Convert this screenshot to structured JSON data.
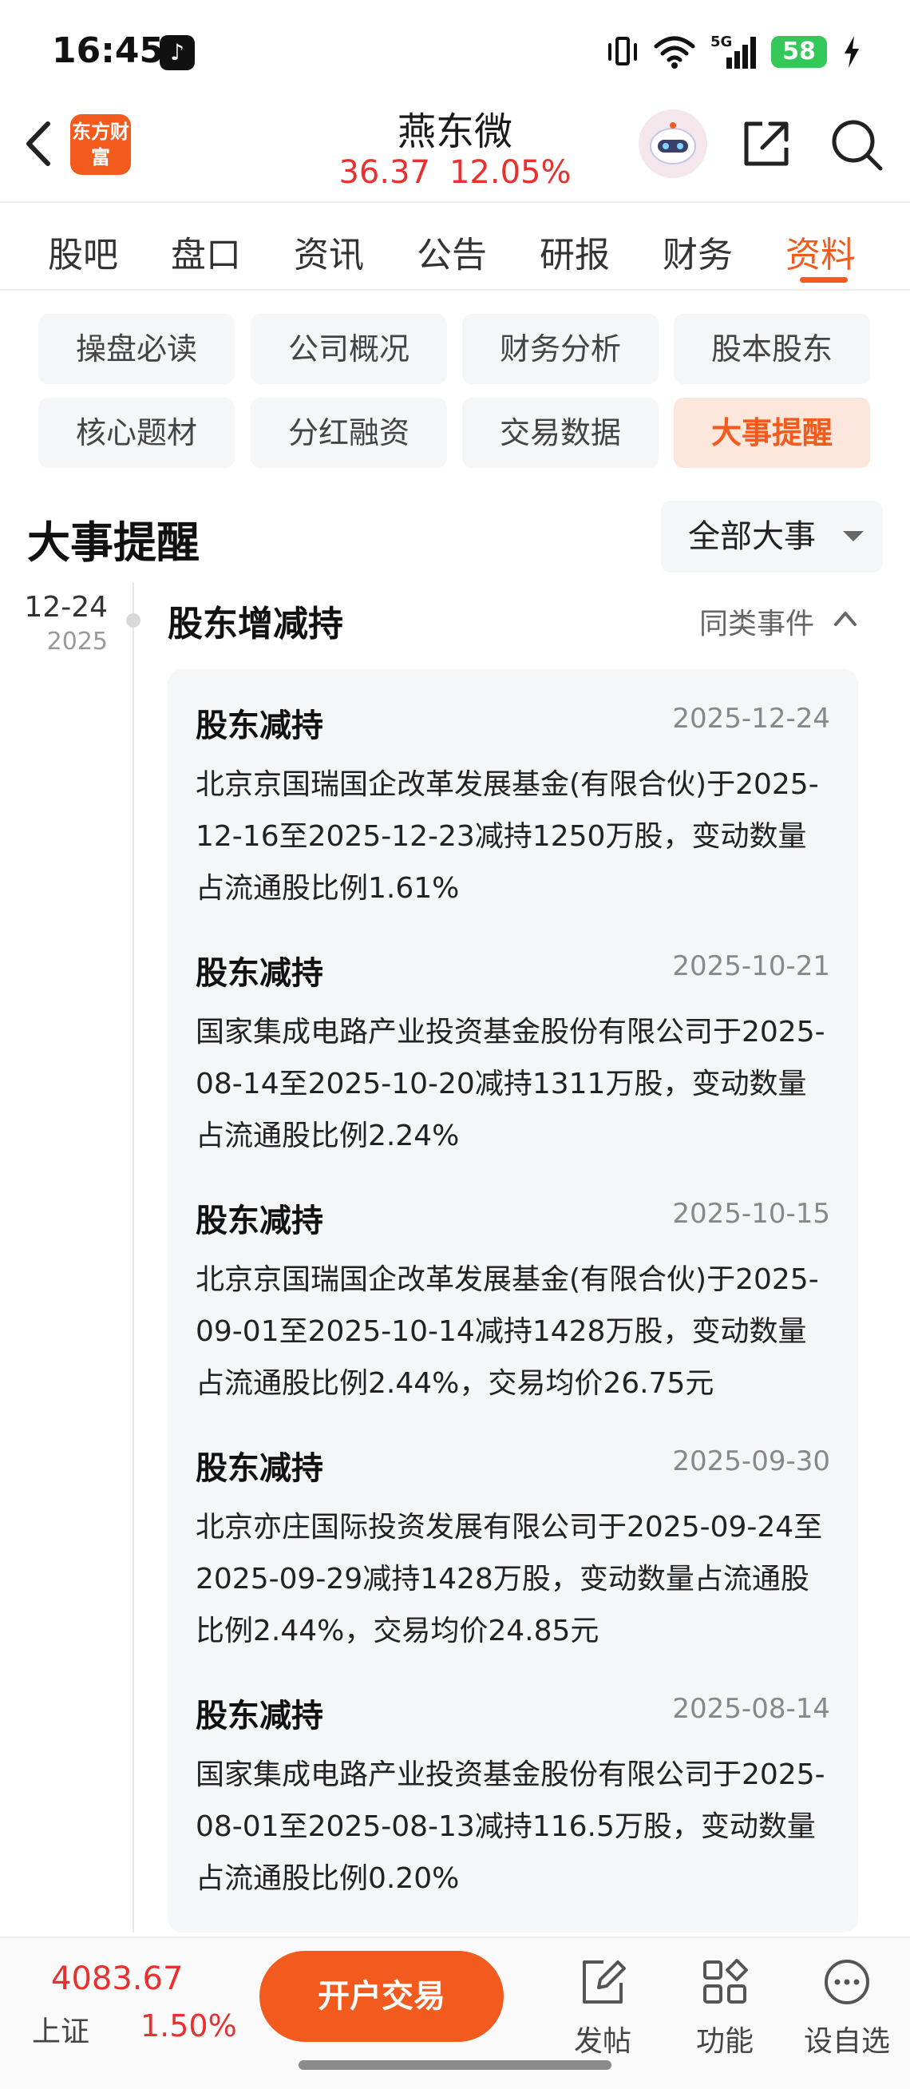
{
  "status_bar": {
    "time": "16:45",
    "network": "5G",
    "battery": "58"
  },
  "header": {
    "logo_text": "东方财富",
    "stock_name": "燕东微",
    "price": "36.37",
    "change_pct": "12.05%"
  },
  "tabs": [
    {
      "label": "股吧",
      "active": false
    },
    {
      "label": "盘口",
      "active": false
    },
    {
      "label": "资讯",
      "active": false
    },
    {
      "label": "公告",
      "active": false
    },
    {
      "label": "研报",
      "active": false
    },
    {
      "label": "财务",
      "active": false
    },
    {
      "label": "资料",
      "active": true
    }
  ],
  "subnav": [
    {
      "label": "操盘必读",
      "active": false
    },
    {
      "label": "公司概况",
      "active": false
    },
    {
      "label": "财务分析",
      "active": false
    },
    {
      "label": "股本股东",
      "active": false
    },
    {
      "label": "核心题材",
      "active": false
    },
    {
      "label": "分红融资",
      "active": false
    },
    {
      "label": "交易数据",
      "active": false
    },
    {
      "label": "大事提醒",
      "active": true
    }
  ],
  "section": {
    "title": "大事提醒",
    "filter": "全部大事"
  },
  "timeline": {
    "date": "12-24",
    "year": "2025",
    "group_title": "股东增减持",
    "similar_label": "同类事件",
    "events": [
      {
        "title": "股东减持",
        "date": "2025-12-24",
        "desc": "北京京国瑞国企改革发展基金(有限合伙)于2025-12-16至2025-12-23减持1250万股，变动数量占流通股比例1.61%"
      },
      {
        "title": "股东减持",
        "date": "2025-10-21",
        "desc": "国家集成电路产业投资基金股份有限公司于2025-08-14至2025-10-20减持1311万股，变动数量占流通股比例2.24%"
      },
      {
        "title": "股东减持",
        "date": "2025-10-15",
        "desc": "北京京国瑞国企改革发展基金(有限合伙)于2025-09-01至2025-10-14减持1428万股，变动数量占流通股比例2.44%，交易均价26.75元"
      },
      {
        "title": "股东减持",
        "date": "2025-09-30",
        "desc": "北京亦庄国际投资发展有限公司于2025-09-24至2025-09-29减持1428万股，变动数量占流通股比例2.44%，交易均价24.85元"
      },
      {
        "title": "股东减持",
        "date": "2025-08-14",
        "desc": "国家集成电路产业投资基金股份有限公司于2025-08-01至2025-08-13减持116.5万股，变动数量占流通股比例0.20%"
      }
    ]
  },
  "bottom_bar": {
    "index_value": "4083.67",
    "index_name": "上证",
    "index_change": "1.50%",
    "open_trade": "开户交易",
    "nav": [
      {
        "label": "发帖",
        "icon": "edit-icon"
      },
      {
        "label": "功能",
        "icon": "grid-icon"
      },
      {
        "label": "设自选",
        "icon": "more-icon"
      }
    ]
  },
  "colors": {
    "accent": "#f25a1e",
    "up_red": "#e8312f"
  }
}
